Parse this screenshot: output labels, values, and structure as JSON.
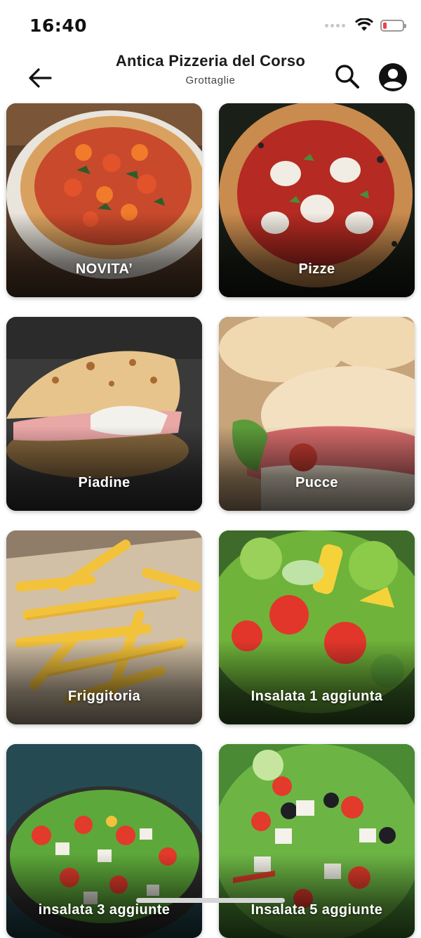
{
  "status_bar": {
    "time": "16:40",
    "wifi_icon": "wifi-icon",
    "battery_icon": "battery-low-icon",
    "battery_color": "#e5484d"
  },
  "header": {
    "title": "Antica Pizzeria del Corso",
    "subtitle": "Grottaglie",
    "back_icon": "arrow-left-icon",
    "search_icon": "search-icon",
    "account_icon": "account-circle-icon"
  },
  "categories": [
    {
      "label": "NOVITA’",
      "image": "pizza-margherita-image"
    },
    {
      "label": "Pizze",
      "image": "pizza-gourmet-image"
    },
    {
      "label": "Piadine",
      "image": "piadina-image"
    },
    {
      "label": "Pucce",
      "image": "pucce-image"
    },
    {
      "label": "Friggitoria",
      "image": "french-fries-image"
    },
    {
      "label": "Insalata 1 aggiunta",
      "image": "salad-image"
    },
    {
      "label": "insalata 3 aggiunte",
      "image": "salad-feta-image"
    },
    {
      "label": "Insalata 5 aggiunte",
      "image": "salad-greek-image"
    }
  ]
}
